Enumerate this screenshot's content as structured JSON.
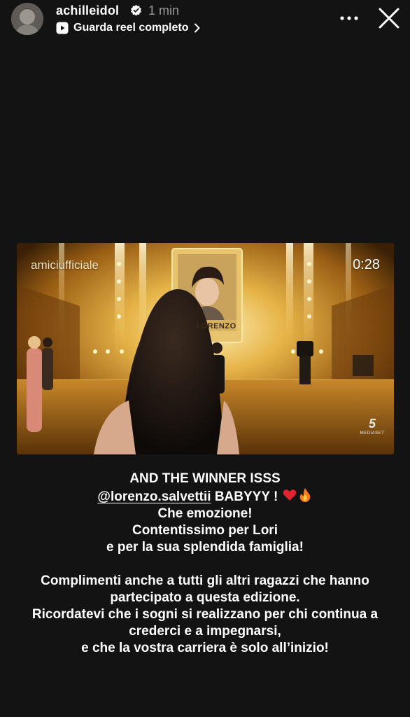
{
  "header": {
    "username": "achilleidol",
    "time": "1 min",
    "reel_link": "Guarda reel completo",
    "icons": [
      "avatar",
      "verified-badge-icon",
      "reel-icon",
      "chevron-right-icon",
      "more-icon",
      "close-icon"
    ]
  },
  "video": {
    "channel": "amiciufficiale",
    "timestamp": "0:28",
    "card_name": "LORENZO",
    "watermark_number": "5",
    "watermark_brand": "MEDIASET"
  },
  "caption": {
    "line1": "AND THE WINNER ISSS",
    "mention": "@lorenzo.salvettii",
    "line2_rest": " BABYYY ! ",
    "line3": "Che emozione!",
    "line4": "Contentissimo per Lori",
    "line5": "e per la sua splendida famiglia!",
    "line6": "Complimenti anche a tutti gli altri ragazzi che hanno",
    "line7": "partecipato a questa edizione.",
    "line8": "Ricordatevi che i sogni si realizzano per chi continua a",
    "line9": "crederci e a impegnarsi,",
    "line10": "e che la vostra carriera è solo all’inizio!",
    "emojis": [
      "heart-emoji",
      "fire-emoji"
    ]
  },
  "colors": {
    "background": "#131313",
    "text": "#ffffff",
    "secondary_text": "#9a9a9a",
    "verified": "#ffffff",
    "stage_gold": "#d8a232"
  }
}
